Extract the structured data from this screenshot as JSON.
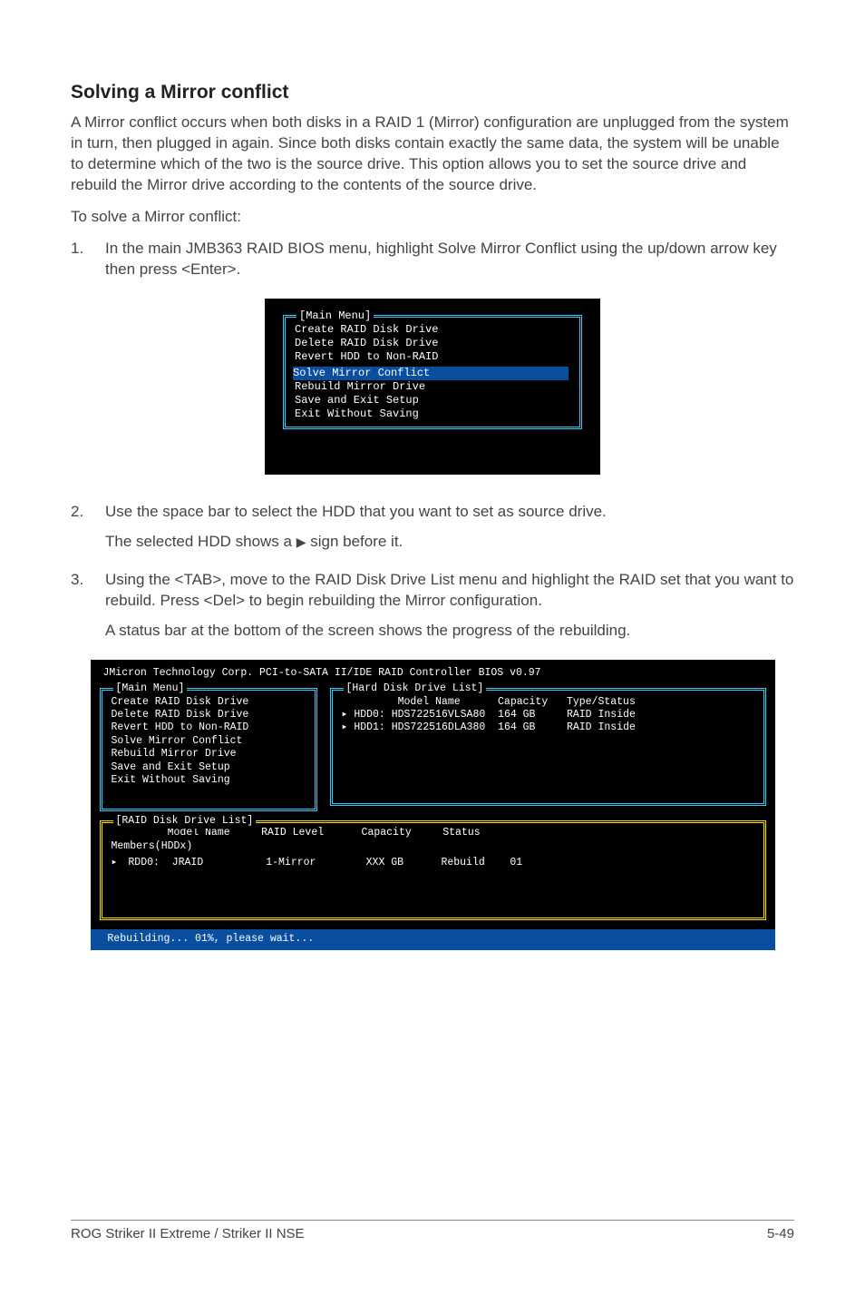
{
  "heading": "Solving a Mirror conflict",
  "para1": "A Mirror conflict occurs when both disks in a RAID 1 (Mirror) configuration are unplugged from the system in turn, then plugged in again. Since both disks contain exactly the same data, the system will be unable to determine which of the two is the source drive. This option allows you to set the source drive and rebuild the Mirror drive according to the contents of the source drive.",
  "para2": "To solve a Mirror conflict:",
  "step1_num": "1.",
  "step1_text": "In the main JMB363 RAID BIOS menu, highlight Solve Mirror Conflict using the up/down arrow key then press <Enter>.",
  "bios1": {
    "legend": "[Main Menu]",
    "items": [
      "Create RAID Disk Drive",
      "Delete RAID Disk Drive",
      "Revert HDD to Non-RAID"
    ],
    "highlight": "Solve Mirror Conflict",
    "items2": [
      "Rebuild Mirror Drive",
      "Save and Exit Setup",
      "Exit Without Saving"
    ]
  },
  "step2_num": "2.",
  "step2_text_a": "Use the space bar to select the HDD that you want to set as source drive.",
  "step2_text_b_pre": "The selected HDD shows a ",
  "step2_text_b_post": " sign before it.",
  "step3_num": "3.",
  "step3_text_a": "Using the <TAB>, move to the RAID Disk Drive List menu and highlight the RAID set that you want to rebuild. Press <Del> to begin rebuilding the Mirror configuration.",
  "step3_text_b": "A status bar at the bottom of the screen shows the progress of the rebuilding.",
  "bios2": {
    "title": "JMicron Technology Corp. PCI-to-SATA II/IDE RAID Controller BIOS v0.97",
    "main_legend": "[Main Menu]",
    "main_items": [
      "Create RAID Disk Drive",
      "Delete RAID Disk Drive",
      "Revert HDD to Non-RAID",
      "Solve Mirror Conflict",
      "Rebuild Mirror Drive",
      "Save and Exit Setup",
      "Exit Without Saving"
    ],
    "hdd_legend": "[Hard Disk Drive List]",
    "hdd_header": "         Model Name      Capacity   Type/Status",
    "hdd_rows": [
      "▸ HDD0: HDS722516VLSA80  164 GB     RAID Inside",
      "▸ HDD1: HDS722516DLA380  164 GB     RAID Inside"
    ],
    "raid_legend": "[RAID Disk Drive List]",
    "raid_header": "         Model Name     RAID Level      Capacity     Status",
    "raid_members": "Members(HDDx)",
    "raid_row_marker": "▸",
    "raid_row": " RDD0:  JRAID          1-Mirror        XXX GB      Rebuild    01",
    "status": " Rebuilding... 01%, please wait..."
  },
  "footer_left": "ROG Striker II Extreme / Striker II NSE",
  "footer_right": "5-49"
}
